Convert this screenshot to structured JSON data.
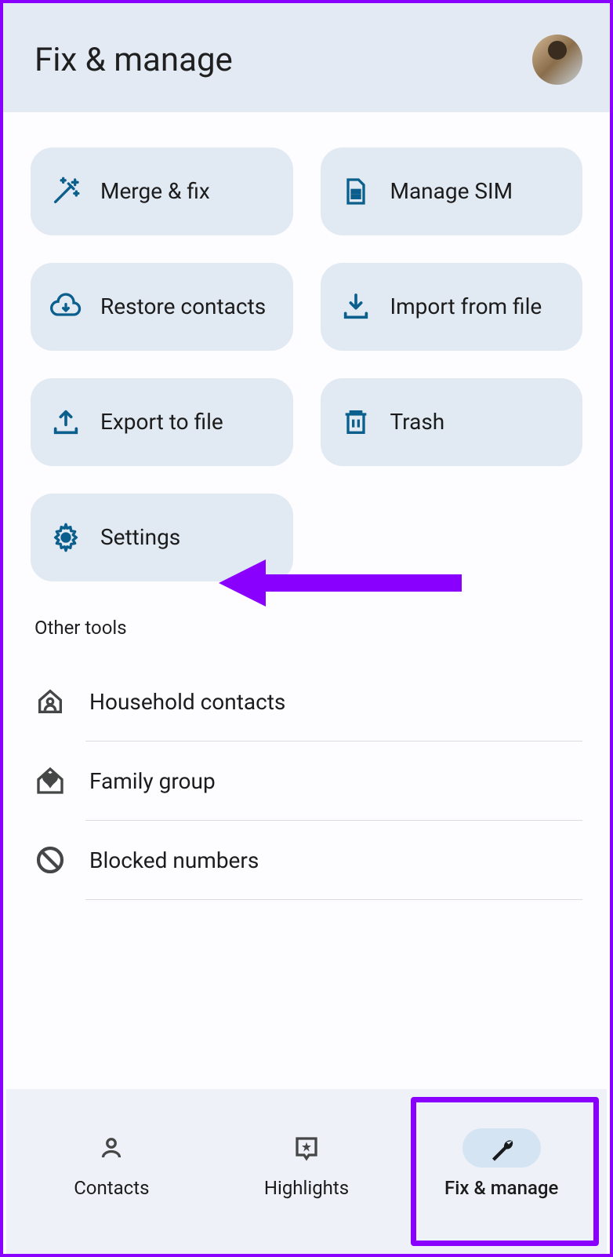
{
  "header": {
    "title": "Fix & manage"
  },
  "tiles": {
    "merge_fix": "Merge & fix",
    "manage_sim": "Manage SIM",
    "restore": "Restore contacts",
    "import": "Import from file",
    "export": "Export to file",
    "trash": "Trash",
    "settings": "Settings"
  },
  "section": {
    "other_tools": "Other tools"
  },
  "tools": {
    "household": "Household contacts",
    "family": "Family group",
    "blocked": "Blocked numbers"
  },
  "nav": {
    "contacts": "Contacts",
    "highlights": "Highlights",
    "fix_manage": "Fix & manage"
  },
  "colors": {
    "icon": "#0b5f8d",
    "tool_icon": "#444746",
    "annotation": "#8a00ff"
  }
}
